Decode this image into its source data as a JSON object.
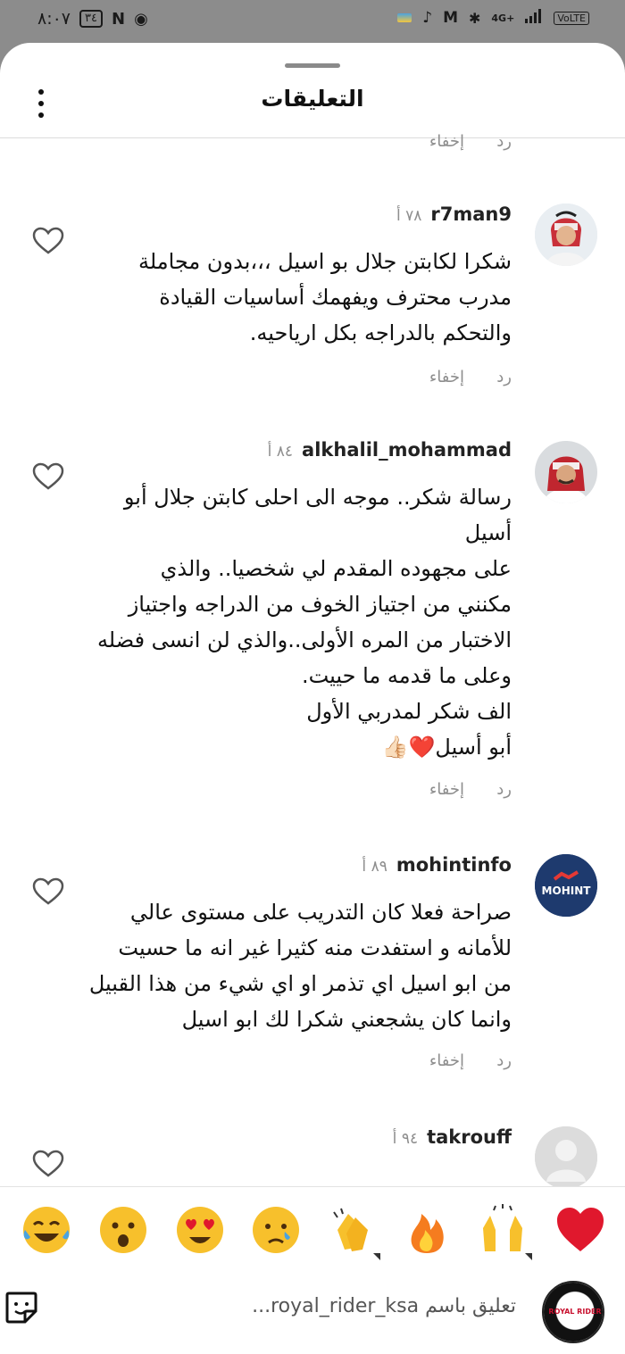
{
  "status_bar": {
    "time": "٨:٠٧",
    "battery": "٣٤",
    "network": "4G+",
    "volte": "VoLTE"
  },
  "header": {
    "title": "التعليقات",
    "menu_icon": "more-vertical-icon"
  },
  "actions": {
    "reply": "رد",
    "hide": "إخفاء"
  },
  "comments": [
    {
      "username": "r7man9",
      "time": "٧٨ أ",
      "text": "شكرا لكابتن جلال بو اسيل ،،،بدون مجاملة\nمدرب محترف ويفهمك أساسيات القيادة\nوالتحكم بالدراجه بكل ارياحيه."
    },
    {
      "username": "alkhalil_mohammad",
      "time": "٨٤ أ",
      "text": "رسالة شكر.. موجه الى احلى كابتن جلال أبو\nأسيل\nعلى مجهوده المقدم لي شخصيا.. والذي\nمكنني من اجتياز الخوف من الدراجه واجتياز\nالاختبار من المره الأولى..والذي لن انسى فضله\nوعلى ما قدمه ما حييت.\nالف شكر لمدربي الأول\nأبو أسيل❤️👍🏻"
    },
    {
      "username": "mohintinfo",
      "time": "٨٩ أ",
      "avatar_text": "MOHINT",
      "text": "صراحة فعلا كان التدريب على مستوى عالي\nللأمانه و استفدت منه كثيرا غير انه ما حسيت\nمن ابو اسيل اي تذمر او اي شيء من هذا القبيل\nوانما كان يشجعني شكرا لك ابو اسيل"
    },
    {
      "username": "takrouff",
      "time": "٩٤ أ",
      "text": ""
    }
  ],
  "emoji_bar": [
    "heart",
    "raising-hands",
    "fire",
    "clapping-hands",
    "crying-face",
    "heart-eyes",
    "surprised-face",
    "laughing-tears"
  ],
  "composer": {
    "placeholder": "تعليق باسم royal_rider_ksa...",
    "avatar_text": "ROYAL RIDER",
    "sticker_icon": "sticker-icon"
  },
  "colors": {
    "accent_heart": "#e0182d",
    "muted": "#8e8e8e",
    "text": "#111111",
    "mohint_bg": "#1e3a6e"
  }
}
